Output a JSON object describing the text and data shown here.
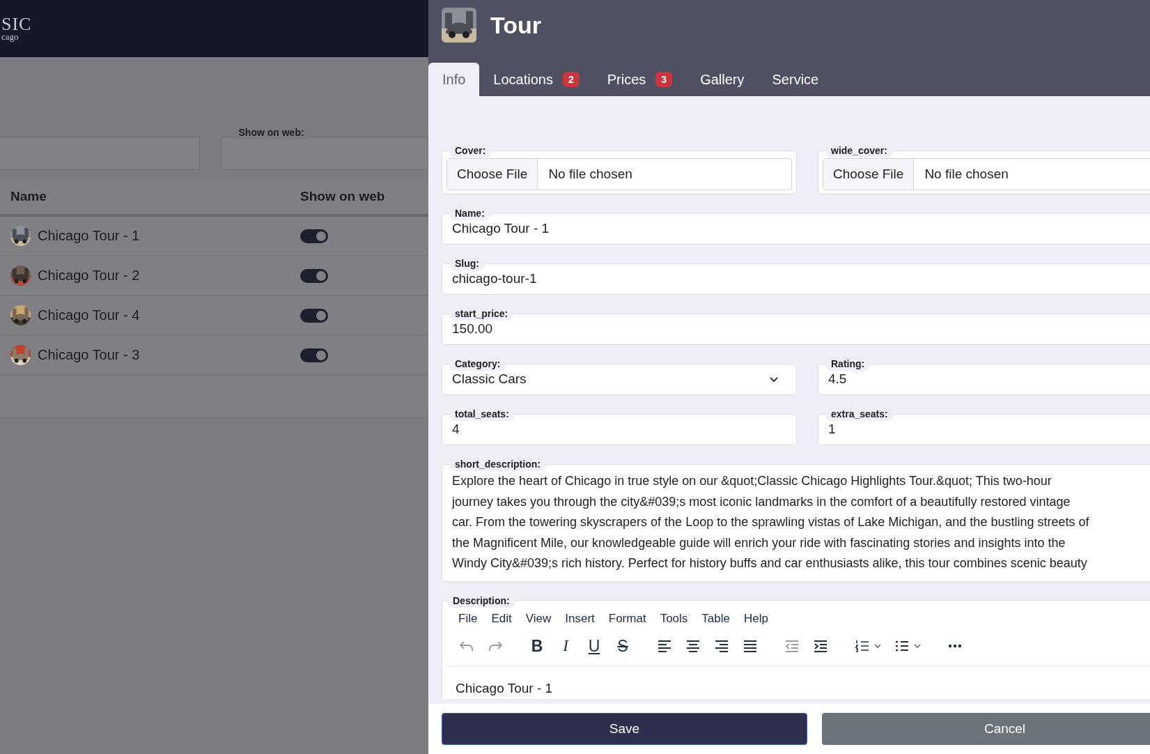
{
  "list_page": {
    "logo": {
      "line_1": "SIC",
      "line_2": "cago"
    },
    "filters": [
      {
        "kind": "input"
      },
      {
        "kind": "select",
        "label": "Show on web:"
      }
    ],
    "table": {
      "columns": [
        "Name",
        "Show on web"
      ],
      "rows": [
        {
          "name": "Chicago Tour - 1",
          "show_on_web": true
        },
        {
          "name": "Chicago Tour - 2",
          "show_on_web": true
        },
        {
          "name": "Chicago Tour - 4",
          "show_on_web": true
        },
        {
          "name": "Chicago Tour - 3",
          "show_on_web": true
        }
      ]
    }
  },
  "drawer": {
    "title": "Tour",
    "tabs": [
      {
        "label": "Info",
        "selected": true
      },
      {
        "label": "Locations",
        "badge": "2",
        "selected": false
      },
      {
        "label": "Prices",
        "badge": "3",
        "selected": false
      },
      {
        "label": "Gallery",
        "selected": false
      },
      {
        "label": "Service",
        "selected": false
      }
    ],
    "rows": [
      [
        {
          "kind": "file",
          "label": "Cover:",
          "button": "Choose File",
          "value": "No file chosen"
        },
        {
          "kind": "file",
          "label": "wide_cover:",
          "button": "Choose File",
          "value": "No file chosen"
        }
      ],
      [
        {
          "kind": "text",
          "label": "Name:",
          "value": "Chicago Tour - 1"
        }
      ],
      [
        {
          "kind": "text",
          "label": "Slug:",
          "value": "chicago-tour-1"
        }
      ],
      [
        {
          "kind": "text",
          "label": "start_price:",
          "value": "150.00"
        }
      ],
      [
        {
          "kind": "select",
          "label": "Category:",
          "value": "Classic Cars"
        },
        {
          "kind": "text",
          "label": "Rating:",
          "value": "4.5"
        }
      ],
      [
        {
          "kind": "text",
          "label": "total_seats:",
          "value": "4"
        },
        {
          "kind": "text",
          "label": "extra_seats:",
          "value": "1"
        }
      ],
      [
        {
          "kind": "textarea",
          "label": "short_description:",
          "lines": [
            "Explore the heart of Chicago in true style on our &quot;Classic Chicago Highlights Tour.&quot; This two-hour",
            "journey takes you through the city&#039;s most iconic landmarks in the comfort of a beautifully restored vintage",
            "car. From the towering skyscrapers of the Loop to the sprawling vistas of Lake Michigan, and the bustling streets of",
            "the Magnificent Mile, our knowledgeable guide will enrich your ride with fascinating stories and insights into the",
            "Windy City&#039;s rich history. Perfect for history buffs and car enthusiasts alike, this tour combines scenic beauty"
          ]
        }
      ]
    ],
    "description": {
      "label": "Description:",
      "menu": [
        "File",
        "Edit",
        "View",
        "Insert",
        "Format",
        "Tools",
        "Table",
        "Help"
      ],
      "toolbar": [
        [
          {
            "kind": "undo",
            "disabled": true
          },
          {
            "kind": "redo",
            "disabled": true
          }
        ],
        [
          {
            "kind": "bold",
            "label": "B",
            "disabled": false
          },
          {
            "kind": "italic",
            "label": "I",
            "disabled": false
          },
          {
            "kind": "underline",
            "label": "U",
            "disabled": false
          },
          {
            "kind": "strike",
            "label": "S",
            "disabled": false
          }
        ],
        [
          {
            "kind": "align-left",
            "disabled": false
          },
          {
            "kind": "align-center",
            "disabled": false
          },
          {
            "kind": "align-right",
            "disabled": false
          },
          {
            "kind": "justify",
            "disabled": false
          }
        ],
        [
          {
            "kind": "outdent",
            "disabled": true
          },
          {
            "kind": "indent",
            "disabled": false
          }
        ],
        [
          {
            "kind": "numlist",
            "disabled": false
          },
          {
            "kind": "bullist",
            "disabled": false
          }
        ],
        [
          {
            "kind": "more",
            "disabled": false
          }
        ]
      ],
      "content": "Chicago Tour - 1"
    },
    "buttons": [
      {
        "kind": "primary",
        "label": "Save"
      },
      {
        "kind": "secondary",
        "label": "Cancel"
      }
    ]
  }
}
